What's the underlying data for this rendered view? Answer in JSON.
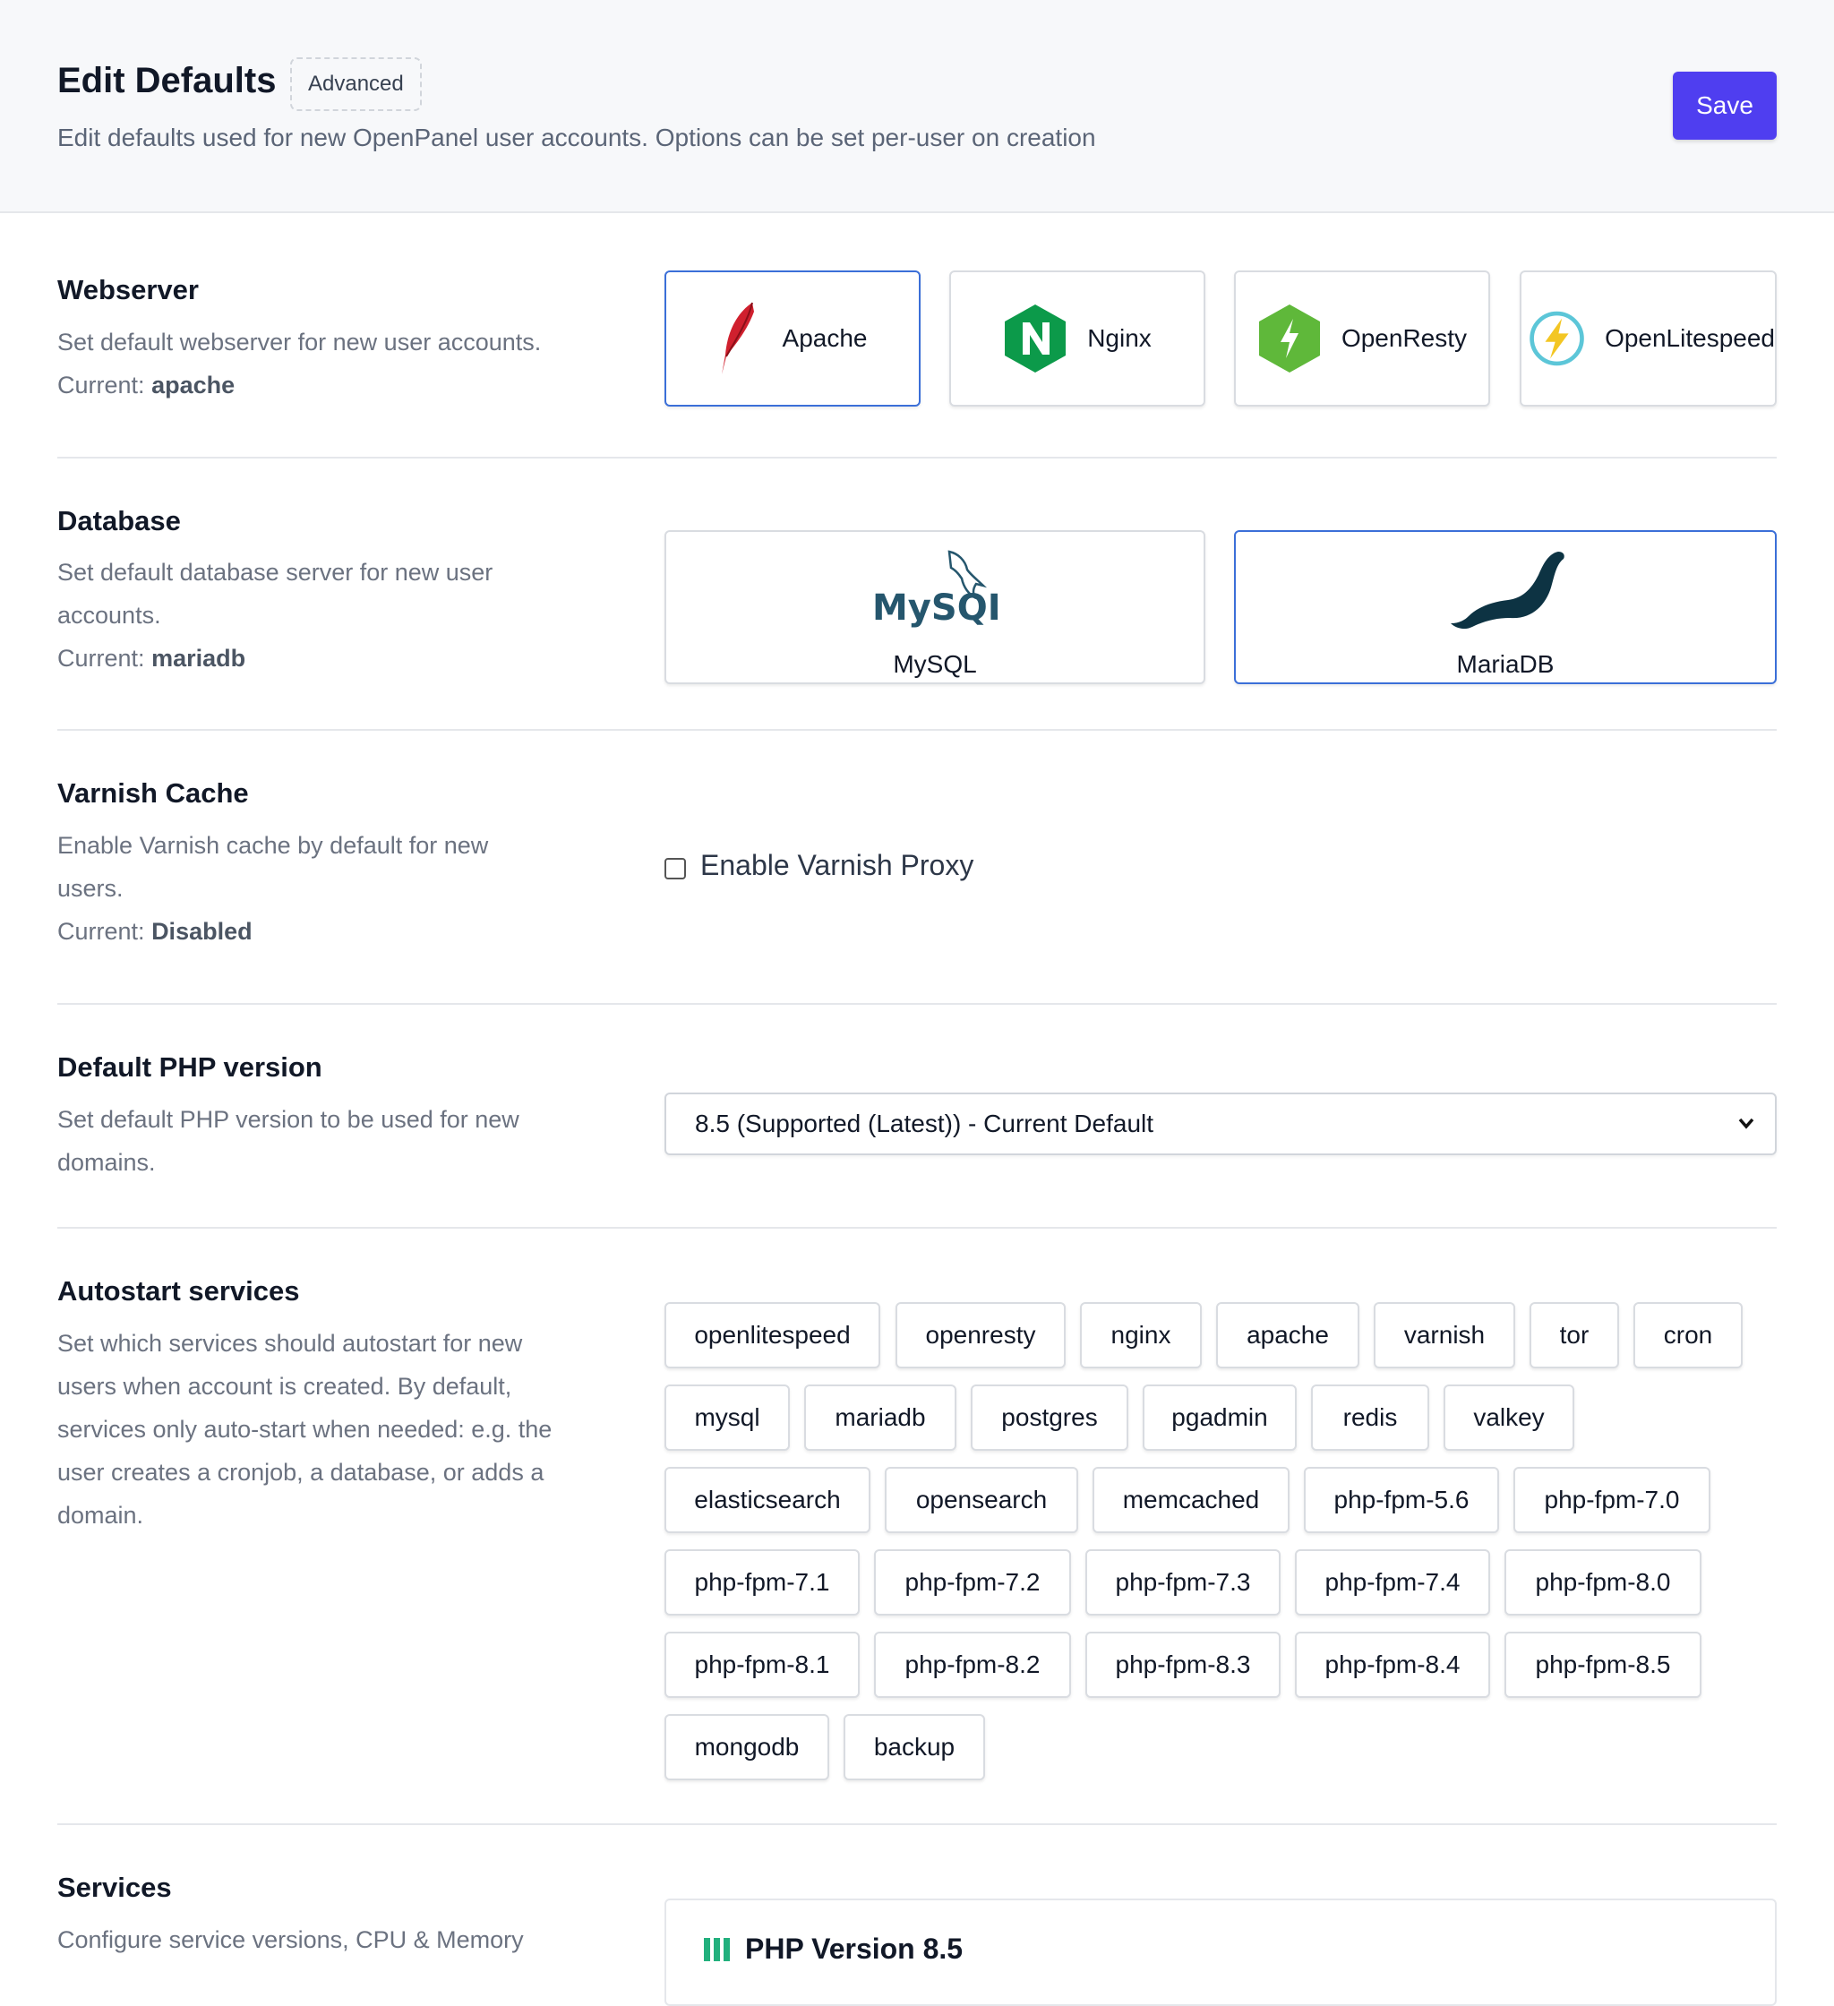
{
  "header": {
    "title": "Edit Defaults",
    "badge": "Advanced",
    "description": "Edit defaults used for new OpenPanel user accounts. Options can be set per-user on creation",
    "save_label": "Save"
  },
  "webserver": {
    "title": "Webserver",
    "description": "Set default webserver for new user accounts.",
    "current_label": "Current:",
    "current_value": "apache",
    "options": [
      {
        "label": "Apache",
        "icon": "apache-feather-icon",
        "selected": true
      },
      {
        "label": "Nginx",
        "icon": "nginx-icon",
        "selected": false
      },
      {
        "label": "OpenResty",
        "icon": "openresty-icon",
        "selected": false
      },
      {
        "label": "OpenLitespeed",
        "icon": "openlitespeed-icon",
        "selected": false
      }
    ]
  },
  "database": {
    "title": "Database",
    "description": "Set default database server for new user accounts.",
    "current_label": "Current:",
    "current_value": "mariadb",
    "options": [
      {
        "label": "MySQL",
        "logo_text": "MySQL",
        "icon": "mysql-dolphin-icon",
        "selected": false
      },
      {
        "label": "MariaDB",
        "icon": "mariadb-seal-icon",
        "selected": true
      }
    ]
  },
  "varnish": {
    "title": "Varnish Cache",
    "description": "Enable Varnish cache by default for new users.",
    "current_label": "Current:",
    "current_value": "Disabled",
    "checkbox_label": "Enable Varnish Proxy",
    "checked": false
  },
  "php": {
    "title": "Default PHP version",
    "description": "Set default PHP version to be used for new domains.",
    "selected_value": "8.5 (Supported (Latest)) - Current Default"
  },
  "autostart": {
    "title": "Autostart services",
    "description": "Set which services should autostart for new users when account is created. By default, services only auto-start when needed: e.g. the user creates a cronjob, a database, or adds a domain.",
    "services": [
      "openlitespeed",
      "openresty",
      "nginx",
      "apache",
      "varnish",
      "tor",
      "cron",
      "mysql",
      "mariadb",
      "postgres",
      "pgadmin",
      "redis",
      "valkey",
      "elasticsearch",
      "opensearch",
      "memcached",
      "php-fpm-5.6",
      "php-fpm-7.0",
      "php-fpm-7.1",
      "php-fpm-7.2",
      "php-fpm-7.3",
      "php-fpm-7.4",
      "php-fpm-8.0",
      "php-fpm-8.1",
      "php-fpm-8.2",
      "php-fpm-8.3",
      "php-fpm-8.4",
      "php-fpm-8.5",
      "mongodb",
      "backup"
    ]
  },
  "services": {
    "title": "Services",
    "description": "Configure service versions, CPU & Memory",
    "php_card_title": "PHP Version 8.5"
  },
  "colors": {
    "accent": "#4f3ef0",
    "selected_border": "#3b6fd8",
    "php_bars": "#22b07d"
  }
}
